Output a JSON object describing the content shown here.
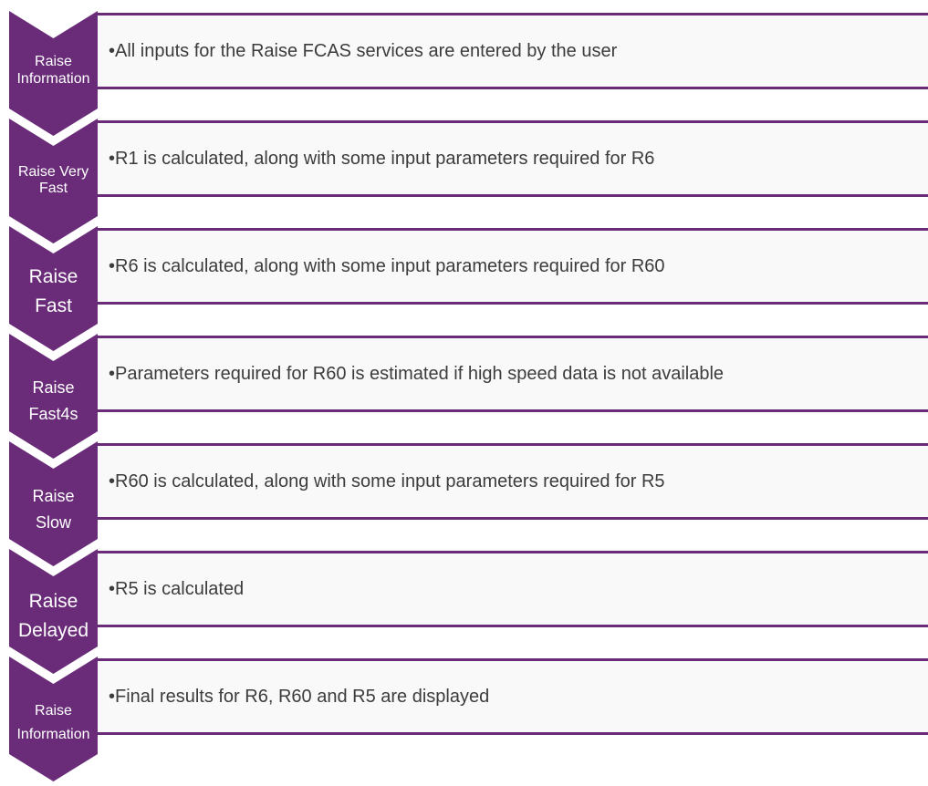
{
  "colors": {
    "chevron": "#6a2c79",
    "border": "#6a2c79",
    "box": "#f9f9f9",
    "text": "#3c3c3c"
  },
  "steps": [
    {
      "label_lines": [
        "Raise",
        "Information"
      ],
      "text": "•All inputs for the Raise FCAS services are entered by the user"
    },
    {
      "label_lines": [
        "Raise Very",
        "Fast"
      ],
      "text": "•R1 is calculated, along with some input parameters required for R6"
    },
    {
      "label_lines": [
        "Raise",
        "Fast"
      ],
      "text": "•R6 is calculated, along with some input parameters required for R60"
    },
    {
      "label_lines": [
        "Raise",
        "Fast4s"
      ],
      "text": "•Parameters required for R60 is estimated if high speed data is not available"
    },
    {
      "label_lines": [
        "Raise",
        "Slow"
      ],
      "text": "•R60 is calculated, along with some input parameters required for R5"
    },
    {
      "label_lines": [
        "Raise",
        "Delayed"
      ],
      "text": "•R5 is calculated"
    },
    {
      "label_lines": [
        "Raise",
        "Information"
      ],
      "text": "•Final results for R6, R60 and R5 are displayed"
    }
  ]
}
